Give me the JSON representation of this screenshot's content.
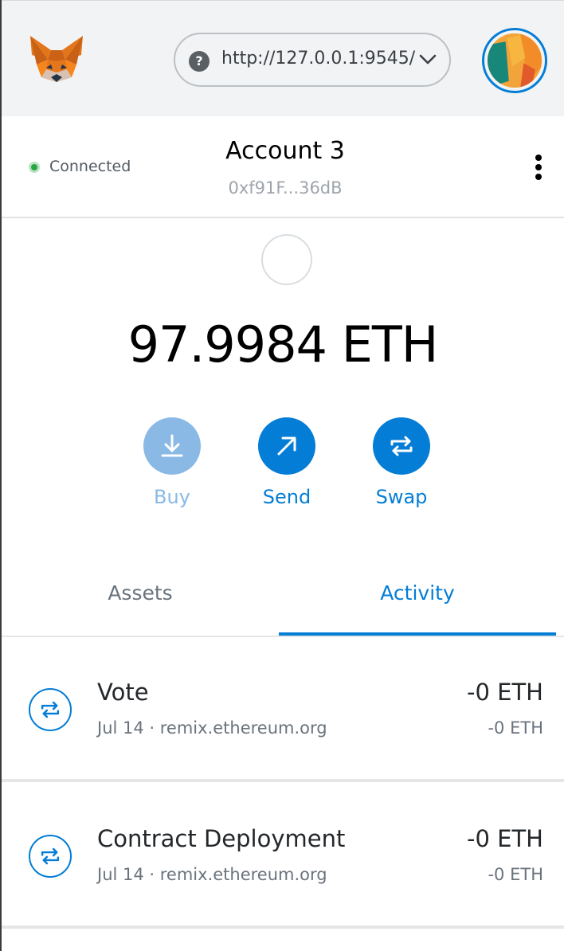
{
  "header": {
    "network_url": "http://127.0.0.1:9545/",
    "logo": "metamask-fox-logo",
    "help_icon": "?"
  },
  "account": {
    "connection_status": "Connected",
    "name": "Account 3",
    "address": "0xf91F...36dB"
  },
  "balance": {
    "display": "97.9984 ETH"
  },
  "actions": {
    "buy_label": "Buy",
    "send_label": "Send",
    "swap_label": "Swap"
  },
  "tabs": {
    "assets_label": "Assets",
    "activity_label": "Activity",
    "active": "Activity"
  },
  "transactions": [
    {
      "title": "Vote",
      "subtitle": "Jul 14 · remix.ethereum.org",
      "amount": "-0 ETH",
      "secondary_amount": "-0 ETH"
    },
    {
      "title": "Contract Deployment",
      "subtitle": "Jul 14 · remix.ethereum.org",
      "amount": "-0 ETH",
      "secondary_amount": "-0 ETH"
    }
  ],
  "colors": {
    "primary": "#037dd6",
    "primary_disabled": "#8ab9e6",
    "connected": "#28a745",
    "header_bg": "#f2f3f4"
  }
}
